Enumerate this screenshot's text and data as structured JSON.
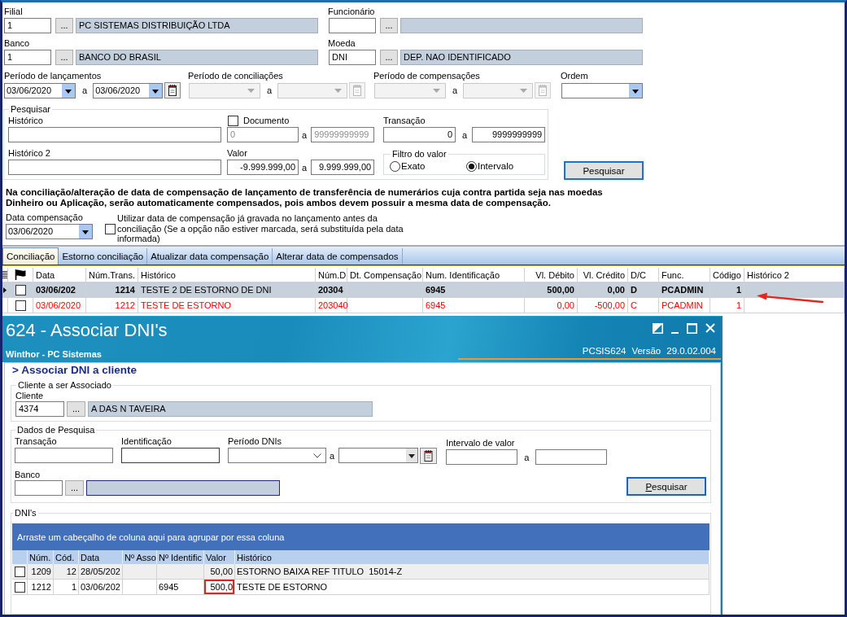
{
  "lookup_rows": [
    [
      {
        "label": "Filial",
        "code": "1",
        "lookup": "...",
        "name": "PC SISTEMAS DISTRIBUIÇÃO LTDA"
      },
      {
        "label": "Funcionário",
        "lookup": "..."
      }
    ],
    [
      {
        "label": "Banco",
        "code": "1",
        "lookup": "...",
        "name": "BANCO DO BRASIL"
      },
      {
        "label": "Moeda",
        "code": "DNI",
        "lookup": "...",
        "name": "DEP. NAO IDENTIFICADO"
      }
    ]
  ],
  "periods": [
    {
      "label": "Período de lançamentos",
      "disabled": false,
      "from": "03/06/2020",
      "separator": "a",
      "to": "03/06/2020"
    },
    {
      "label": "Período de conciliações",
      "disabled": true,
      "separator": "a"
    },
    {
      "label": "Período de compensações",
      "disabled": true,
      "separator": "a"
    }
  ],
  "order": {
    "label": "Ordem"
  },
  "search": {
    "title": "Pesquisar",
    "history": {
      "label": "Histórico"
    },
    "document": {
      "label": "Documento",
      "checked": false,
      "disabled": true,
      "from": "0",
      "separator": "a",
      "to": "99999999999"
    },
    "transaction": {
      "label": "Transação",
      "from": "0",
      "separator": "a",
      "to": "9999999999"
    },
    "history_2": {
      "label": "Histórico 2"
    },
    "value": {
      "label": "Valor",
      "from": "-9.999.999,00",
      "separator": "a",
      "to": "9.999.999,00"
    },
    "filter": {
      "title": "Filtro do valor",
      "options": [
        {
          "label": "Exato",
          "selected": false
        },
        {
          "label": "Intervalo",
          "selected": true
        }
      ]
    },
    "button": "Pesquisar"
  },
  "notice": "Na conciliação/alteração de data de compensação de lançamento de transferência de numerários cuja contra partida seja nas moedas Dinheiro ou Aplicação, serão automaticamente compensados, pois ambos devem possuir a mesma data de compensação.",
  "compensation": {
    "label": "Data compensação",
    "value": "03/06/2020",
    "use_saved": {
      "checked": false,
      "label": "Utilizar data de compensação já gravada no lançamento antes da conciliação (Se a opção não estiver marcada, será substituída pela data informada)"
    }
  },
  "tabs": [
    {
      "label": "Conciliação",
      "selected": true
    },
    {
      "label": "Estorno conciliação",
      "selected": false
    },
    {
      "label": "Atualizar data compensação",
      "selected": false
    },
    {
      "label": "Alterar data de compensados",
      "selected": false
    }
  ],
  "grid": {
    "columns": [
      "Data",
      "Núm.Trans.",
      "Histórico",
      "Núm.D",
      "Dt. Compensação",
      "Num. Identificação",
      "Vl. Débito",
      "Vl. Crédito",
      "D/C",
      "Func.",
      "Código",
      "Histórico 2"
    ],
    "rows": [
      {
        "selected": true,
        "checked": false,
        "color": "#000000",
        "pointer": true,
        "data": "03/06/202",
        "num_trans": "1214",
        "historico": "TESTE 2 DE ESTORNO DE DNI",
        "num_doc": "20304",
        "num_identificacao": "6945",
        "vl_debito": "500,00",
        "vl_credito": "0,00",
        "dc": "D",
        "func": "PCADMIN",
        "codigo": "1"
      },
      {
        "selected": false,
        "checked": false,
        "color": "#ff0000",
        "pointer": false,
        "data": "03/06/2020",
        "num_trans": "1212",
        "historico": "TESTE DE ESTORNO",
        "num_doc": "203040",
        "num_identificacao": "6945",
        "vl_debito": "0,00",
        "vl_credito": "-500,00",
        "dc": "C",
        "func": "PCADMIN",
        "codigo": "1"
      }
    ]
  },
  "dialog": {
    "title": "624 - Associar DNI's",
    "subtitle": "Winthor - PC Sistemas",
    "program": "PCSIS624",
    "version_label": "Versão",
    "version": "29.0.02.004",
    "heading": "> Associar DNI a cliente",
    "client": {
      "title": "Cliente a ser Associado",
      "label": "Cliente",
      "code": "4374",
      "lookup": "...",
      "name": "A DAS N TAVEIRA"
    },
    "search": {
      "title": "Dados de Pesquisa",
      "transaction": {
        "label": "Transação"
      },
      "identification": {
        "label": "Identificação"
      },
      "period": {
        "label": "Período DNIs",
        "separator": "a"
      },
      "amount_range": {
        "label": "Intervalo de valor",
        "separator": "a"
      },
      "bank": {
        "label": "Banco",
        "lookup": "..."
      },
      "button": "Pesquisar"
    },
    "dnis": {
      "title": "DNI's",
      "group_hint": "Arraste um cabeçalho de coluna aqui para agrupar por essa coluna",
      "columns": [
        "Núm.",
        "Cód.",
        "Data",
        "Nº Asso",
        "Nº Identific",
        "Valor",
        "Histórico"
      ],
      "rows": [
        {
          "selected": true,
          "checked": false,
          "highlighted": false,
          "num": "1209",
          "cod": "12",
          "data": "28/05/202",
          "valor": "50,00",
          "historico": "ESTORNO BAIXA REF TITULO  15014-Z"
        },
        {
          "selected": false,
          "checked": false,
          "highlighted": true,
          "num": "1212",
          "cod": "1",
          "data": "03/06/202",
          "identificacao": "6945",
          "valor": "500,0",
          "historico": "TESTE DE ESTORNO"
        }
      ]
    }
  }
}
